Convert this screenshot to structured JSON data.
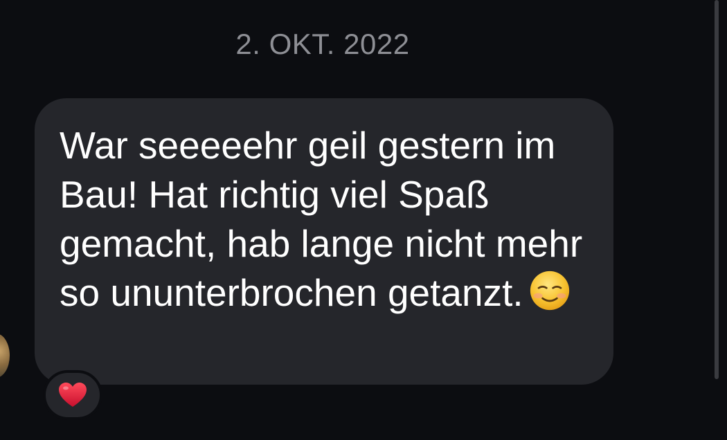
{
  "conversation": {
    "date_separator": "2. OKT. 2022",
    "message": {
      "text": "War seeeeehr geil gestern im Bau! Hat richtig viel Spaß gemacht, hab lange nicht mehr so ununterbrochen getanzt.",
      "emoji": "smiling-face-icon",
      "reaction": "heart-icon"
    }
  },
  "colors": {
    "background": "#0c0d11",
    "bubble": "#25262b",
    "text": "#ffffff",
    "date": "#8e8f95",
    "heart": "#e0243a"
  }
}
